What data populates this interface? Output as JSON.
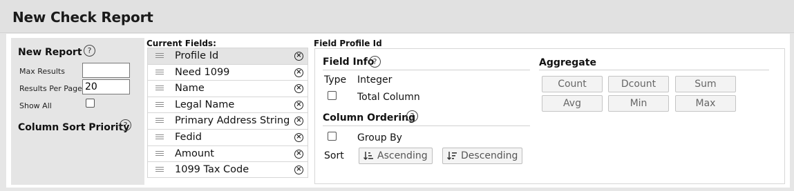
{
  "page": {
    "title": "New Check Report"
  },
  "settings": {
    "heading": "New Report",
    "help_glyph": "?",
    "max_results_label": "Max Results",
    "max_results_value": "",
    "results_per_page_label": "Results Per Page",
    "results_per_page_value": "20",
    "show_all_label": "Show All",
    "show_all_checked": false,
    "sort_priority_heading": "Column Sort Priority"
  },
  "fields": {
    "title": "Current Fields:",
    "items": [
      {
        "label": "Profile Id",
        "selected": true
      },
      {
        "label": "Need 1099",
        "selected": false
      },
      {
        "label": "Name",
        "selected": false
      },
      {
        "label": "Legal Name",
        "selected": false
      },
      {
        "label": "Primary Address String",
        "selected": false
      },
      {
        "label": "Fedid",
        "selected": false
      },
      {
        "label": "Amount",
        "selected": false
      },
      {
        "label": "1099 Tax Code",
        "selected": false
      }
    ],
    "remove_glyph": "×"
  },
  "profile": {
    "title": "Field Profile Id",
    "field_info": {
      "heading": "Field Info",
      "type_label": "Type",
      "type_value": "Integer",
      "total_column_label": "Total Column",
      "total_column_checked": false
    },
    "ordering": {
      "heading": "Column Ordering",
      "group_by_label": "Group By",
      "group_by_checked": false,
      "sort_label": "Sort",
      "ascending_label": "Ascending",
      "descending_label": "Descending"
    },
    "aggregate": {
      "heading": "Aggregate",
      "buttons": [
        "Count",
        "Dcount",
        "Sum",
        "Avg",
        "Min",
        "Max"
      ]
    }
  }
}
